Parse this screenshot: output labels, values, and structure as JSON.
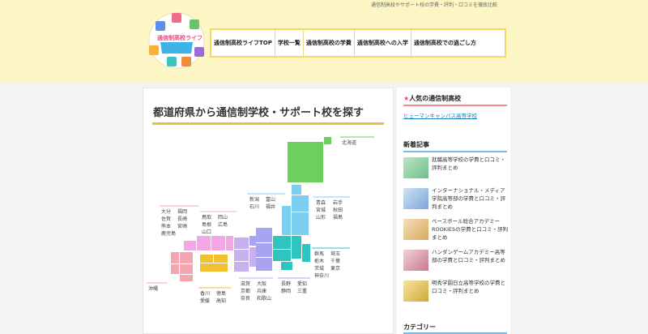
{
  "header": {
    "tagline": "通信制高校やサポート校の学費・評判・口コミを徹底比較",
    "logo_text": "通信制高校ライフ",
    "nav": [
      "通信制高校ライフTOP",
      "学校一覧",
      "通信制高校の学費",
      "通信制高校への入学",
      "通信制高校での過ごし方"
    ]
  },
  "main": {
    "title": "都道府県から通信制学校・サポート校を探す",
    "regions": {
      "hokkaido": [
        "北海道"
      ],
      "tohoku": [
        "青森",
        "岩手",
        "宮城",
        "秋田",
        "山形",
        "福島"
      ],
      "hokuriku": [
        "新潟",
        "富山",
        "石川",
        "福井"
      ],
      "kanto": [
        "群馬",
        "埼玉",
        "栃木",
        "千葉",
        "茨城",
        "東京",
        "神奈川"
      ],
      "chubu": [
        "長野",
        "愛知",
        "静岡",
        "三重"
      ],
      "kinki": [
        "滋賀",
        "大阪",
        "京都",
        "兵庫",
        "奈良",
        "和歌山"
      ],
      "chugoku": [
        "鳥取",
        "岡山",
        "島根",
        "広島",
        "山口"
      ],
      "shikoku": [
        "香川",
        "徳島",
        "愛媛",
        "高知"
      ],
      "kyushu": [
        "大分",
        "福岡",
        "佐賀",
        "長崎",
        "熊本",
        "宮崎",
        "鹿児島"
      ],
      "okinawa": [
        "沖縄"
      ]
    }
  },
  "sidebar": {
    "popular_heading": "人気の通信制高校",
    "popular_link": "ヒューマンキャンパス高等学校",
    "new_heading": "新着記事",
    "articles": [
      "就職高等学校の学費と口コミ・評判まとめ",
      "インターナショナル・メディア学院高等部の学費と口コミ・評判まとめ",
      "ベースボール総合アカデミー ROOKIESの学費と口コミ・評判まとめ",
      "ハンダンゲームアカデミー高等部の学費と口コミ・評判まとめ",
      "明秀学園日立高等学校の学費と口コミ・評判まとめ"
    ],
    "category_heading": "カテゴリー"
  },
  "colors": {
    "header_bg": "#fcf6c4",
    "accent": "#e8c23a",
    "hokkaido": "#6ccf5f",
    "tohoku": "#7ccff0",
    "kanto": "#2ec4c0",
    "chubu": "#a8a4f0",
    "kinki": "#c8b0ee",
    "chugoku": "#f5a6e6",
    "shikoku": "#f0c030",
    "kyushu": "#f2a6b0"
  }
}
